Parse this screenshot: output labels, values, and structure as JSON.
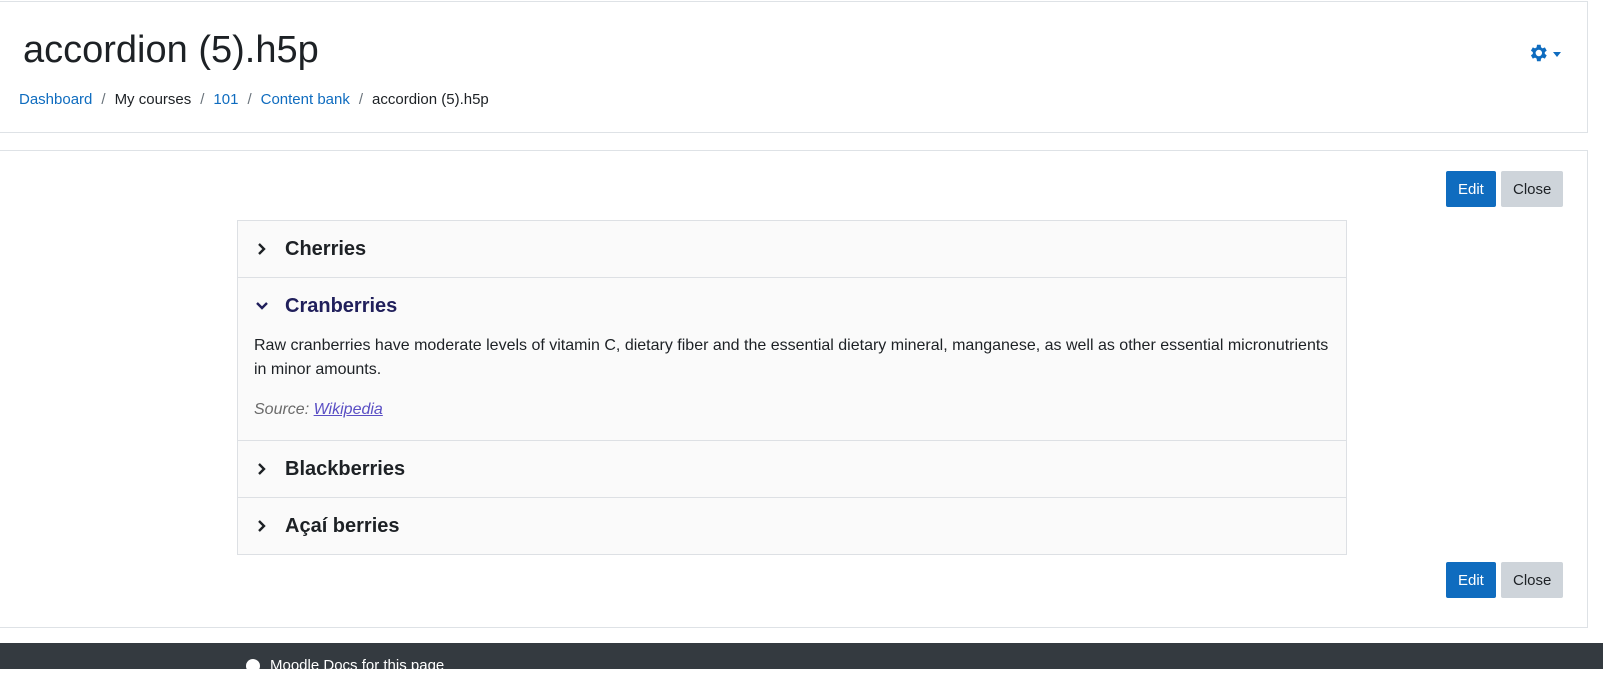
{
  "header": {
    "title": "accordion (5).h5p",
    "breadcrumb": [
      {
        "label": "Dashboard",
        "link": true
      },
      {
        "label": "My courses",
        "link": false
      },
      {
        "label": "101",
        "link": true
      },
      {
        "label": "Content bank",
        "link": true
      },
      {
        "label": "accordion (5).h5p",
        "link": false
      }
    ],
    "settings_icon": "gear-icon"
  },
  "actions": {
    "edit_label": "Edit",
    "close_label": "Close"
  },
  "accordion": {
    "items": [
      {
        "title": "Cherries",
        "expanded": false
      },
      {
        "title": "Cranberries",
        "expanded": true,
        "body": "Raw cranberries have moderate levels of vitamin C, dietary fiber and the essential dietary mineral, manganese, as well as other essential micronutrients in minor amounts.",
        "source_prefix": "Source: ",
        "source_link": "Wikipedia"
      },
      {
        "title": "Blackberries",
        "expanded": false
      },
      {
        "title": "Açaí berries",
        "expanded": false
      }
    ]
  },
  "footer": {
    "docs_link": "Moodle Docs for this page"
  },
  "colors": {
    "primary": "#0f6cbf",
    "secondary": "#ced4da",
    "footer_bg": "#343a40",
    "expanded_title": "#201f5b"
  }
}
